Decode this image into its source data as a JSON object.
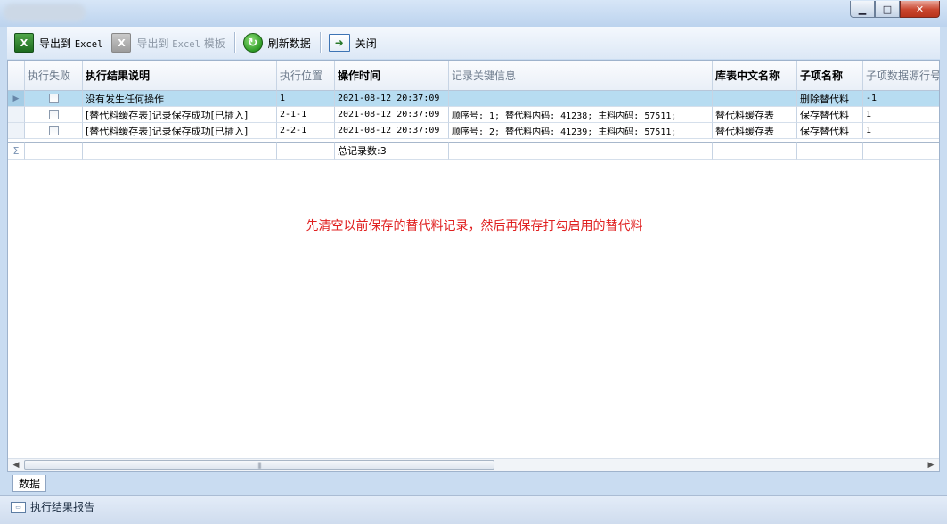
{
  "window": {
    "controls": {
      "minimize": "▁",
      "maximize": "□",
      "close": "✕"
    }
  },
  "toolbar": {
    "export_excel": {
      "prefix": "导出到",
      "mono": "Excel"
    },
    "export_excel_template": {
      "prefix": "导出到",
      "mono": "Excel",
      "suffix": "模板"
    },
    "refresh": "刷新数据",
    "close": "关闭"
  },
  "grid": {
    "columns": [
      "执行失败",
      "执行结果说明",
      "执行位置",
      "操作时间",
      "记录关键信息",
      "库表中文名称",
      "子项名称",
      "子项数据源行号"
    ],
    "rows": [
      {
        "failed": false,
        "desc": "没有发生任何操作",
        "pos": "1",
        "time": "2021-08-12 20:37:09",
        "info": "",
        "table": "",
        "sub": "删除替代料",
        "line": "-1"
      },
      {
        "failed": false,
        "desc": "[替代料缓存表]记录保存成功[已插入]",
        "pos": "2-1-1",
        "time": "2021-08-12 20:37:09",
        "info": "顺序号: 1; 替代料内码: 41238; 主料内码: 57511;",
        "table": "替代料缓存表",
        "sub": "保存替代料",
        "line": "1"
      },
      {
        "failed": false,
        "desc": "[替代料缓存表]记录保存成功[已插入]",
        "pos": "2-2-1",
        "time": "2021-08-12 20:37:09",
        "info": "顺序号: 2; 替代料内码: 41239; 主料内码: 57511;",
        "table": "替代料缓存表",
        "sub": "保存替代料",
        "line": "1"
      }
    ],
    "summary_symbol": "Σ",
    "summary_text": "总记录数:3"
  },
  "annotation": "先清空以前保存的替代料记录，然后再保存打勾启用的替代料",
  "tabs": [
    "数据"
  ],
  "status": {
    "text": "执行结果报告"
  }
}
